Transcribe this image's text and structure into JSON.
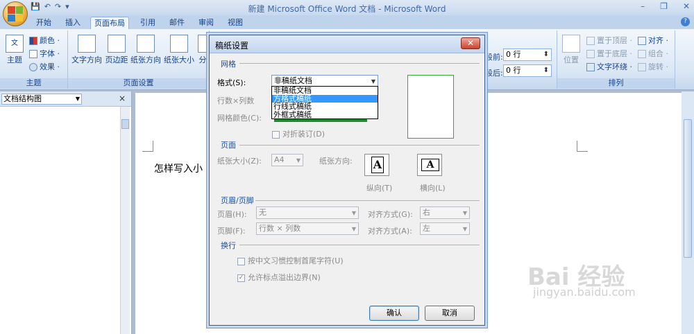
{
  "window": {
    "title": "新建 Microsoft Office Word 文档 - Microsoft Word",
    "qat": [
      "💾",
      "↶",
      "↷",
      "▾"
    ],
    "controls": [
      "–",
      "❐",
      "✕"
    ]
  },
  "tabs": [
    "开始",
    "插入",
    "页面布局",
    "引用",
    "邮件",
    "审阅",
    "视图"
  ],
  "ribbon": {
    "theme_group": {
      "label": "主题",
      "theme_btn": "主题",
      "colors": "颜色 ·",
      "fonts": "字体 ·",
      "effects": "效果 ·"
    },
    "page_setup_group": {
      "label": "页面设置",
      "buttons": [
        "文字方向",
        "页边距",
        "纸张方向",
        "纸张大小",
        "分"
      ]
    },
    "paragraph": {
      "spacing_before_label": "段前:",
      "spacing_before": "0 行",
      "spacing_after_label": "段后:",
      "spacing_after": "0 行"
    },
    "arrange_group": {
      "label": "排列",
      "position": "位置",
      "bring_front": "置于顶层 ·",
      "send_back": "置于底层 ·",
      "text_wrap": "文字环绕 ·",
      "align": "对齐 ·",
      "group": "组合 ·",
      "rotate": "旋转 ·"
    }
  },
  "nav_pane": {
    "select": "文档结构图",
    "close": "×"
  },
  "document": {
    "text": "怎样写入小"
  },
  "watermark": {
    "brand": "Bai 经验",
    "url": "jingyan.baidu.com"
  },
  "dialog": {
    "title": "稿纸设置",
    "close": "✕",
    "grid_section": "网格",
    "format_label": "格式(S):",
    "format_value": "非稿纸文档",
    "format_options": [
      "非稿纸文档",
      "方格式稿纸",
      "行线式稿纸",
      "外框式稿纸"
    ],
    "selected_option": 1,
    "rows_cols_label": "行数×列数",
    "grid_color_label": "网格颜色(C):",
    "fold_checkbox": "对折装订(D)",
    "page_section": "页面",
    "paper_size_label": "纸张大小(Z):",
    "paper_size_value": "A4",
    "orientation_label": "纸张方向:",
    "portrait": "纵向(T)",
    "landscape": "横向(L)",
    "header_footer_section": "页眉/页脚",
    "header_label": "页眉(H):",
    "header_value": "无",
    "header_align_label": "对齐方式(G):",
    "header_align_value": "右",
    "footer_label": "页脚(F):",
    "footer_value": "行数 × 列数",
    "footer_align_label": "对齐方式(A):",
    "footer_align_value": "左",
    "wrap_section": "换行",
    "chinese_rule_checkbox": "按中文习惯控制首尾字符(U)",
    "punctuation_checkbox": "允许标点溢出边界(N)",
    "ok": "确认",
    "cancel": "取消"
  }
}
